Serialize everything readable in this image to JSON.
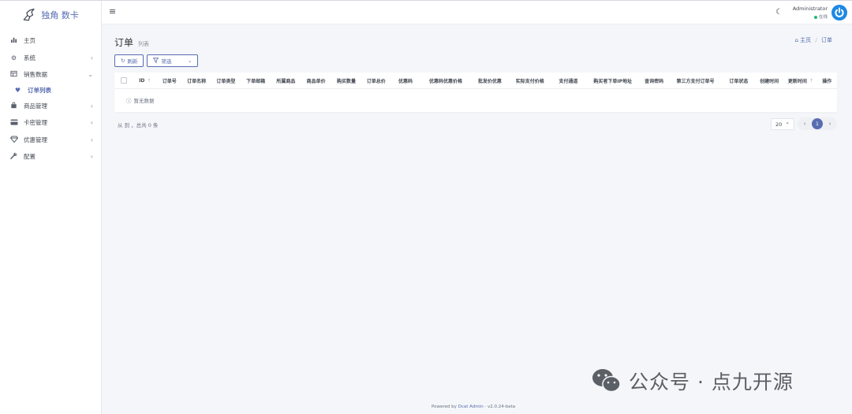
{
  "brand": {
    "title": "独角 数卡"
  },
  "sidebar": {
    "items": [
      {
        "label": "主页",
        "icon": "bar-chart-icon",
        "has_children": false
      },
      {
        "label": "系统",
        "icon": "gear-icon",
        "has_children": true
      },
      {
        "label": "销售数据",
        "icon": "table-icon",
        "has_children": true,
        "expanded": true
      },
      {
        "label": "订单列表",
        "icon": "heart-icon",
        "sub": true
      },
      {
        "label": "商品管理",
        "icon": "shopping-bag-icon",
        "has_children": true
      },
      {
        "label": "卡密管理",
        "icon": "credit-card-icon",
        "has_children": true
      },
      {
        "label": "优惠管理",
        "icon": "diamond-icon",
        "has_children": true
      },
      {
        "label": "配置",
        "icon": "wrench-icon",
        "has_children": true
      }
    ]
  },
  "topbar": {
    "user_name": "Administrator",
    "user_status": "在线",
    "status_color": "#21b978"
  },
  "page": {
    "title": "订单",
    "subtitle": "列表",
    "breadcrumb": {
      "home": "主页",
      "current": "订单"
    }
  },
  "toolbar": {
    "refresh_label": "刷新",
    "filter_label": "筛选"
  },
  "table": {
    "columns": [
      {
        "label": "ID",
        "sortable": true
      },
      {
        "label": "订单号"
      },
      {
        "label": "订单名称"
      },
      {
        "label": "订单类型"
      },
      {
        "label": "下单邮箱"
      },
      {
        "label": "所属商品"
      },
      {
        "label": "商品单价"
      },
      {
        "label": "购买数量"
      },
      {
        "label": "订单总价"
      },
      {
        "label": "优惠码"
      },
      {
        "label": "优惠码优惠价格"
      },
      {
        "label": "批发价优惠"
      },
      {
        "label": "实际支付价格"
      },
      {
        "label": "支付通道"
      },
      {
        "label": "购买者下单IP地址"
      },
      {
        "label": "查询密码"
      },
      {
        "label": "第三方支付订单号"
      },
      {
        "label": "订单状态"
      },
      {
        "label": "创建时间"
      },
      {
        "label": "更新时间",
        "sortable": true
      },
      {
        "label": "操作"
      }
    ],
    "empty_text": "暂无数据"
  },
  "pagination": {
    "summary": "从 到 ，总共 0 条",
    "per_page": "20",
    "current_page": "1"
  },
  "watermark": {
    "text": "公众号 · 点九开源"
  },
  "footer": {
    "prefix": "Powered by",
    "link": "Dcat Admin",
    "sep": "·",
    "version": "v2.0.24-beta"
  },
  "colors": {
    "accent": "#586cb1",
    "avatar": "#1e88e5"
  }
}
